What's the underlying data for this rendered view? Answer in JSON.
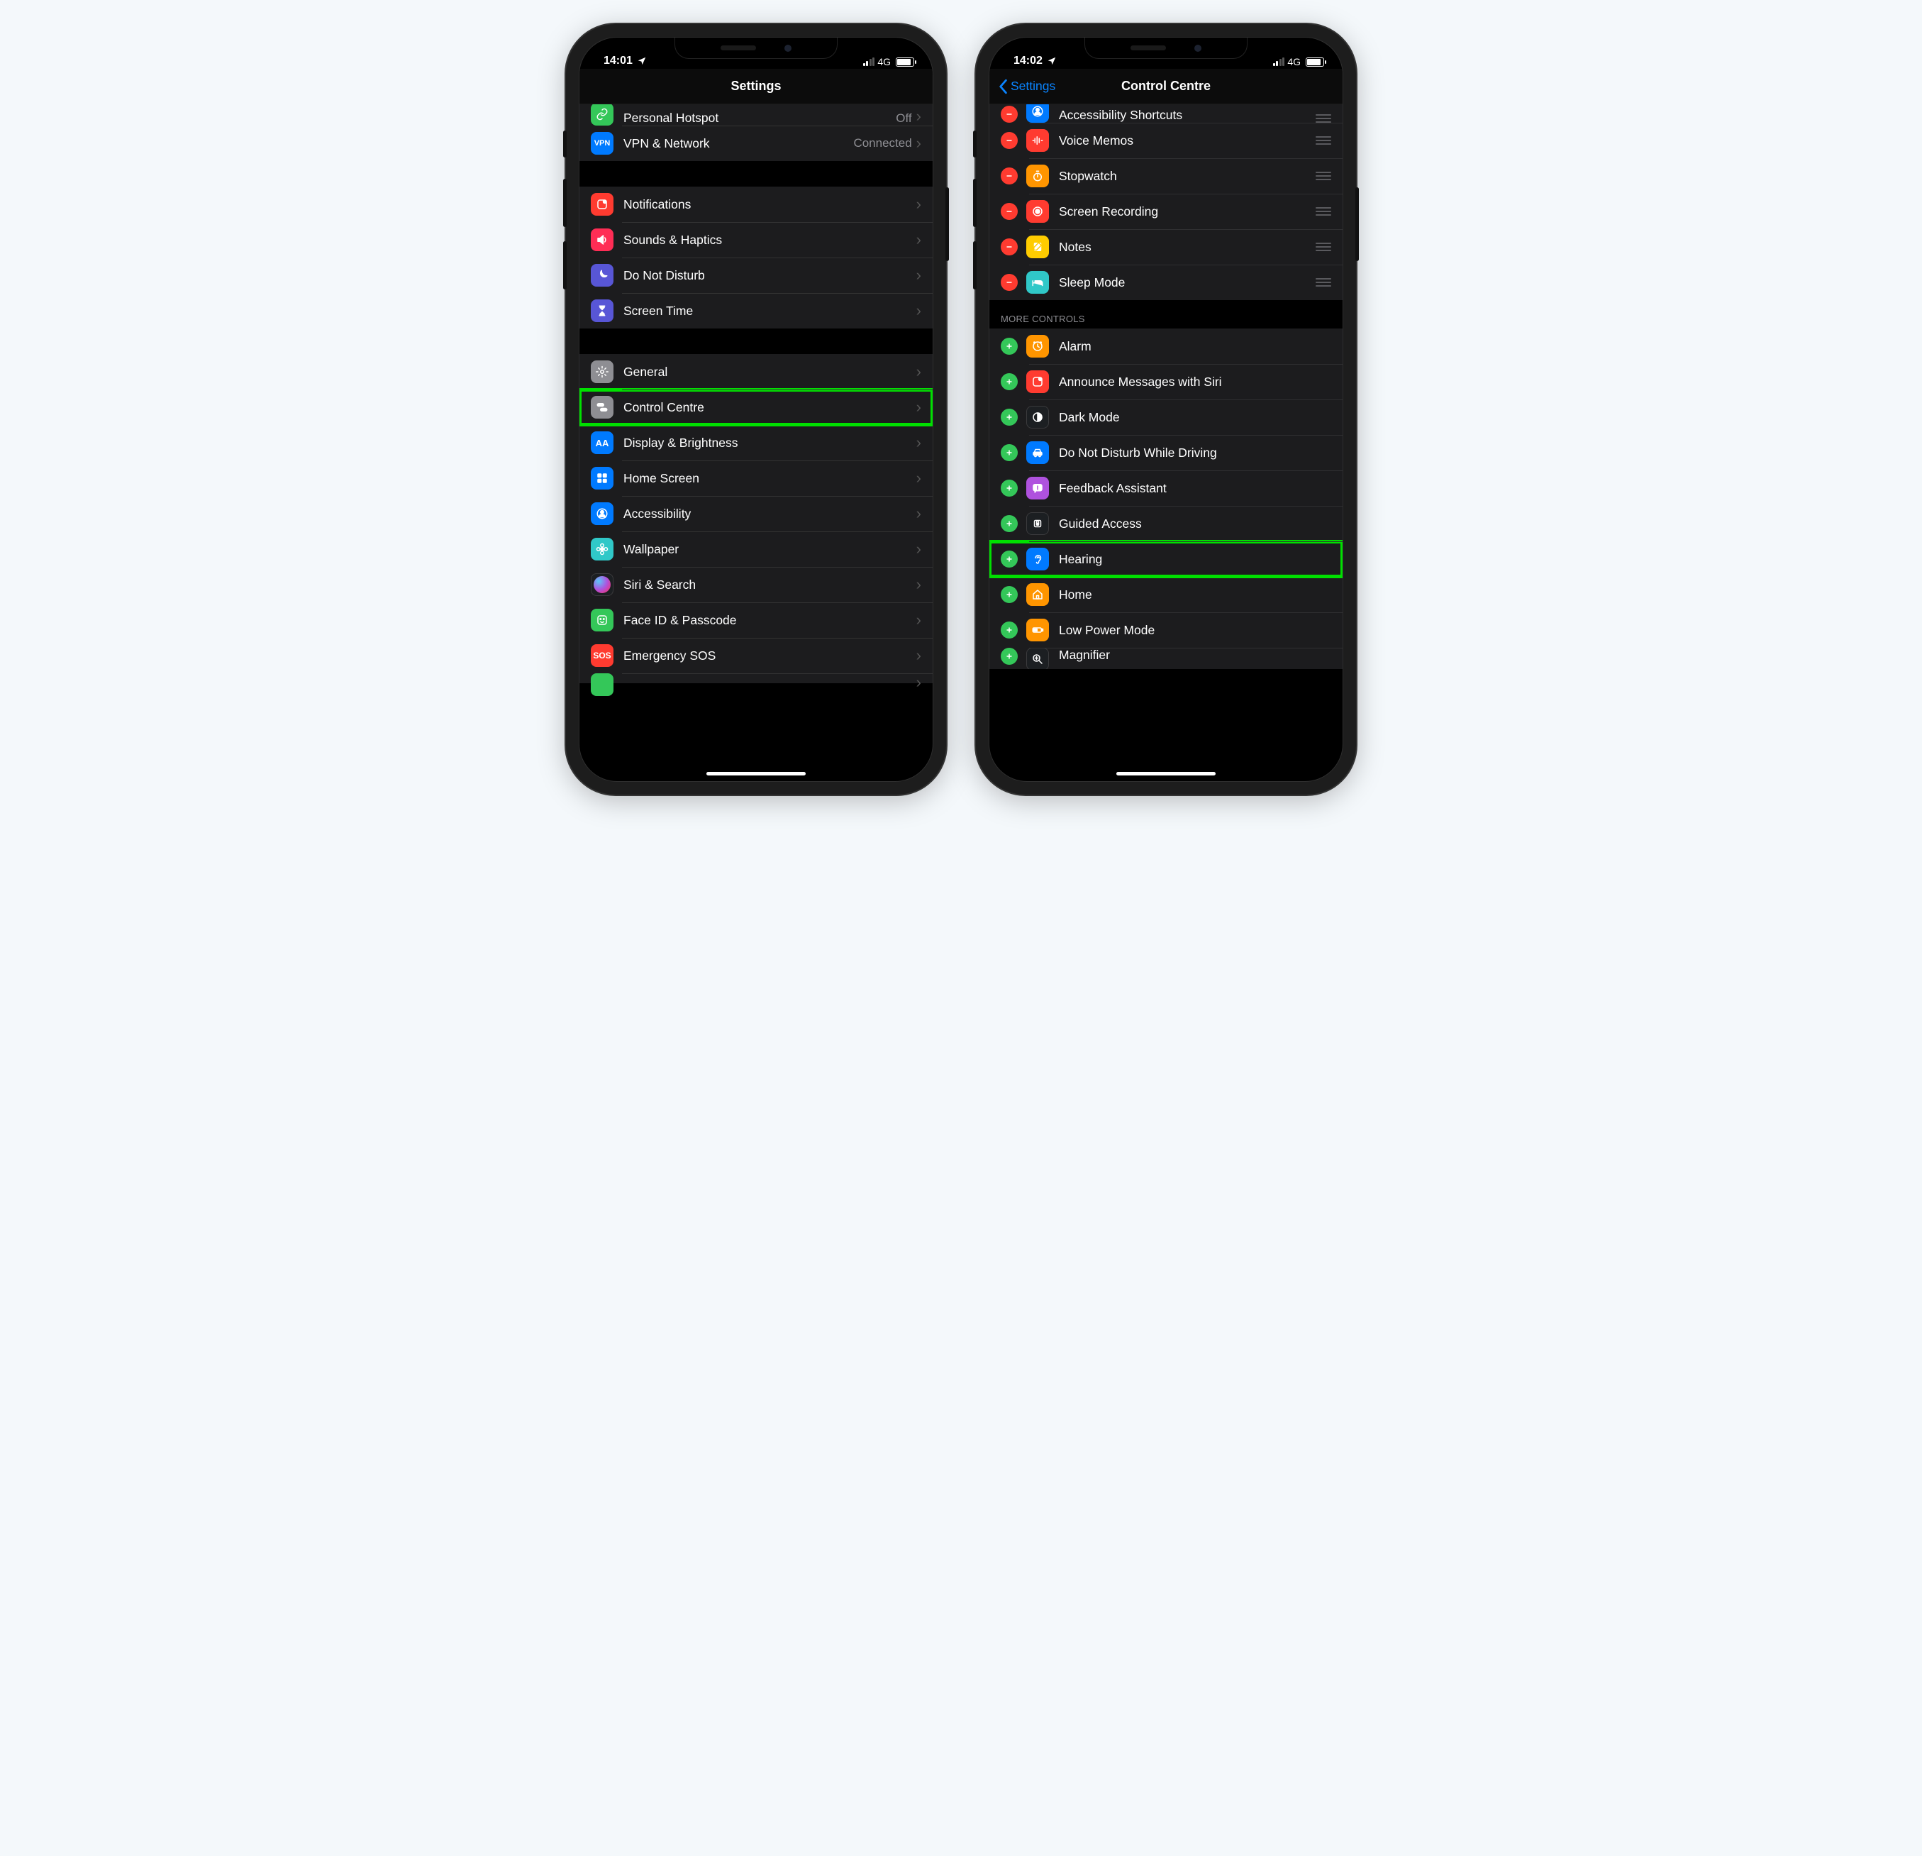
{
  "left": {
    "status": {
      "time": "14:01",
      "network": "4G"
    },
    "nav": {
      "title": "Settings"
    },
    "rows": [
      {
        "id": "hotspot",
        "label": "Personal Hotspot",
        "detail": "Off",
        "icon": "link",
        "bg": "bg-green",
        "partial": "top"
      },
      {
        "id": "vpn",
        "label": "VPN & Network",
        "detail": "Connected",
        "icon": "vpn",
        "bg": "bg-blue"
      },
      {
        "gap": true
      },
      {
        "id": "notifications",
        "label": "Notifications",
        "icon": "notif",
        "bg": "bg-red"
      },
      {
        "id": "sounds",
        "label": "Sounds & Haptics",
        "icon": "speaker",
        "bg": "bg-pink"
      },
      {
        "id": "dnd",
        "label": "Do Not Disturb",
        "icon": "moon",
        "bg": "bg-indigo"
      },
      {
        "id": "screentime",
        "label": "Screen Time",
        "icon": "hourglass",
        "bg": "bg-indigo"
      },
      {
        "gap": true
      },
      {
        "id": "general",
        "label": "General",
        "icon": "gear",
        "bg": "bg-gray"
      },
      {
        "id": "controlcentre",
        "label": "Control Centre",
        "icon": "toggles",
        "bg": "bg-gray",
        "highlight": true
      },
      {
        "id": "display",
        "label": "Display & Brightness",
        "icon": "aa",
        "bg": "bg-blue"
      },
      {
        "id": "homescreen",
        "label": "Home Screen",
        "icon": "grid",
        "bg": "bg-blue"
      },
      {
        "id": "accessibility",
        "label": "Accessibility",
        "icon": "person",
        "bg": "bg-blue"
      },
      {
        "id": "wallpaper",
        "label": "Wallpaper",
        "icon": "flower",
        "bg": "bg-teal"
      },
      {
        "id": "siri",
        "label": "Siri & Search",
        "icon": "siri",
        "bg": "bg-dark"
      },
      {
        "id": "faceid",
        "label": "Face ID & Passcode",
        "icon": "face",
        "bg": "bg-green"
      },
      {
        "id": "sos",
        "label": "Emergency SOS",
        "icon": "sos",
        "bg": "bg-red"
      },
      {
        "id": "unknown",
        "label": "",
        "icon": "",
        "bg": "bg-green",
        "partial": "bottom"
      }
    ]
  },
  "right": {
    "status": {
      "time": "14:02",
      "network": "4G"
    },
    "nav": {
      "title": "Control Centre",
      "back": "Settings"
    },
    "included_header_hidden": true,
    "included": [
      {
        "id": "a11y-shortcut",
        "label": "Accessibility Shortcuts",
        "icon": "person",
        "bg": "bg-blue",
        "partial": "top"
      },
      {
        "id": "voicememos",
        "label": "Voice Memos",
        "icon": "wave",
        "bg": "bg-red"
      },
      {
        "id": "stopwatch",
        "label": "Stopwatch",
        "icon": "stopwatch",
        "bg": "bg-orange"
      },
      {
        "id": "screenrec",
        "label": "Screen Recording",
        "icon": "rec",
        "bg": "bg-red"
      },
      {
        "id": "notes",
        "label": "Notes",
        "icon": "note",
        "bg": "bg-yellow"
      },
      {
        "id": "sleep",
        "label": "Sleep Mode",
        "icon": "bed",
        "bg": "bg-teal"
      }
    ],
    "more_header": "MORE CONTROLS",
    "more": [
      {
        "id": "alarm",
        "label": "Alarm",
        "icon": "clock",
        "bg": "bg-orange"
      },
      {
        "id": "announce",
        "label": "Announce Messages with Siri",
        "icon": "notif",
        "bg": "bg-red"
      },
      {
        "id": "darkmode",
        "label": "Dark Mode",
        "icon": "halfcircle",
        "bg": "bg-dark"
      },
      {
        "id": "dnd-drive",
        "label": "Do Not Disturb While Driving",
        "icon": "car",
        "bg": "bg-blue"
      },
      {
        "id": "feedback",
        "label": "Feedback Assistant",
        "icon": "bubble",
        "bg": "bg-purple"
      },
      {
        "id": "guided",
        "label": "Guided Access",
        "icon": "lock",
        "bg": "bg-dark"
      },
      {
        "id": "hearing",
        "label": "Hearing",
        "icon": "ear",
        "bg": "bg-blue",
        "highlight": true
      },
      {
        "id": "home",
        "label": "Home",
        "icon": "house",
        "bg": "bg-orange"
      },
      {
        "id": "lowpower",
        "label": "Low Power Mode",
        "icon": "battery",
        "bg": "bg-orange"
      },
      {
        "id": "magnifier",
        "label": "Magnifier",
        "icon": "magnify",
        "bg": "bg-dark",
        "partial": "bottom"
      }
    ]
  }
}
